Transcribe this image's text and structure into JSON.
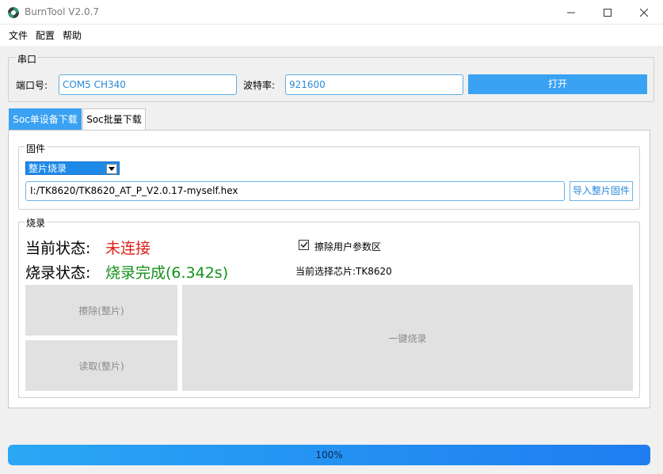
{
  "window": {
    "title": "BurnTool V2.0.7",
    "minimize_icon": "minimize-icon",
    "maximize_icon": "maximize-icon",
    "close_icon": "close-icon"
  },
  "menu": {
    "items": [
      {
        "label": "文件"
      },
      {
        "label": "配置"
      },
      {
        "label": "帮助"
      }
    ]
  },
  "serial": {
    "group_title": "串口",
    "port_label": "端口号:",
    "port_value": "COM5  CH340",
    "baud_label": "波特率:",
    "baud_value": "921600",
    "open_label": "打开"
  },
  "tabs": [
    {
      "label": "Soc单设备下载",
      "active": true
    },
    {
      "label": "Soc批量下载",
      "active": false
    }
  ],
  "firmware": {
    "group_title": "固件",
    "mode_selected": "整片烧录",
    "file_path": "I:/TK8620/TK8620_AT_P_V2.0.17-myself.hex",
    "import_label": "导入整片固件"
  },
  "burn": {
    "group_title": "烧录",
    "current_status_label": "当前状态:",
    "current_status_value": "未连接",
    "burn_status_label": "烧录状态:",
    "burn_status_value": "烧录完成(6.342s)",
    "erase_user_params_label": "擦除用户参数区",
    "erase_user_params_checked": true,
    "selected_chip_text": "当前选择芯片:TK8620",
    "erase_button_label": "擦除(整片)",
    "read_button_label": "读取(整片)",
    "one_click_label": "一键烧录"
  },
  "progress": {
    "value": 1.0,
    "text": "100%"
  },
  "colors": {
    "accent": "#3aa2f2",
    "status_error": "#e0201a",
    "status_success": "#13901a"
  }
}
